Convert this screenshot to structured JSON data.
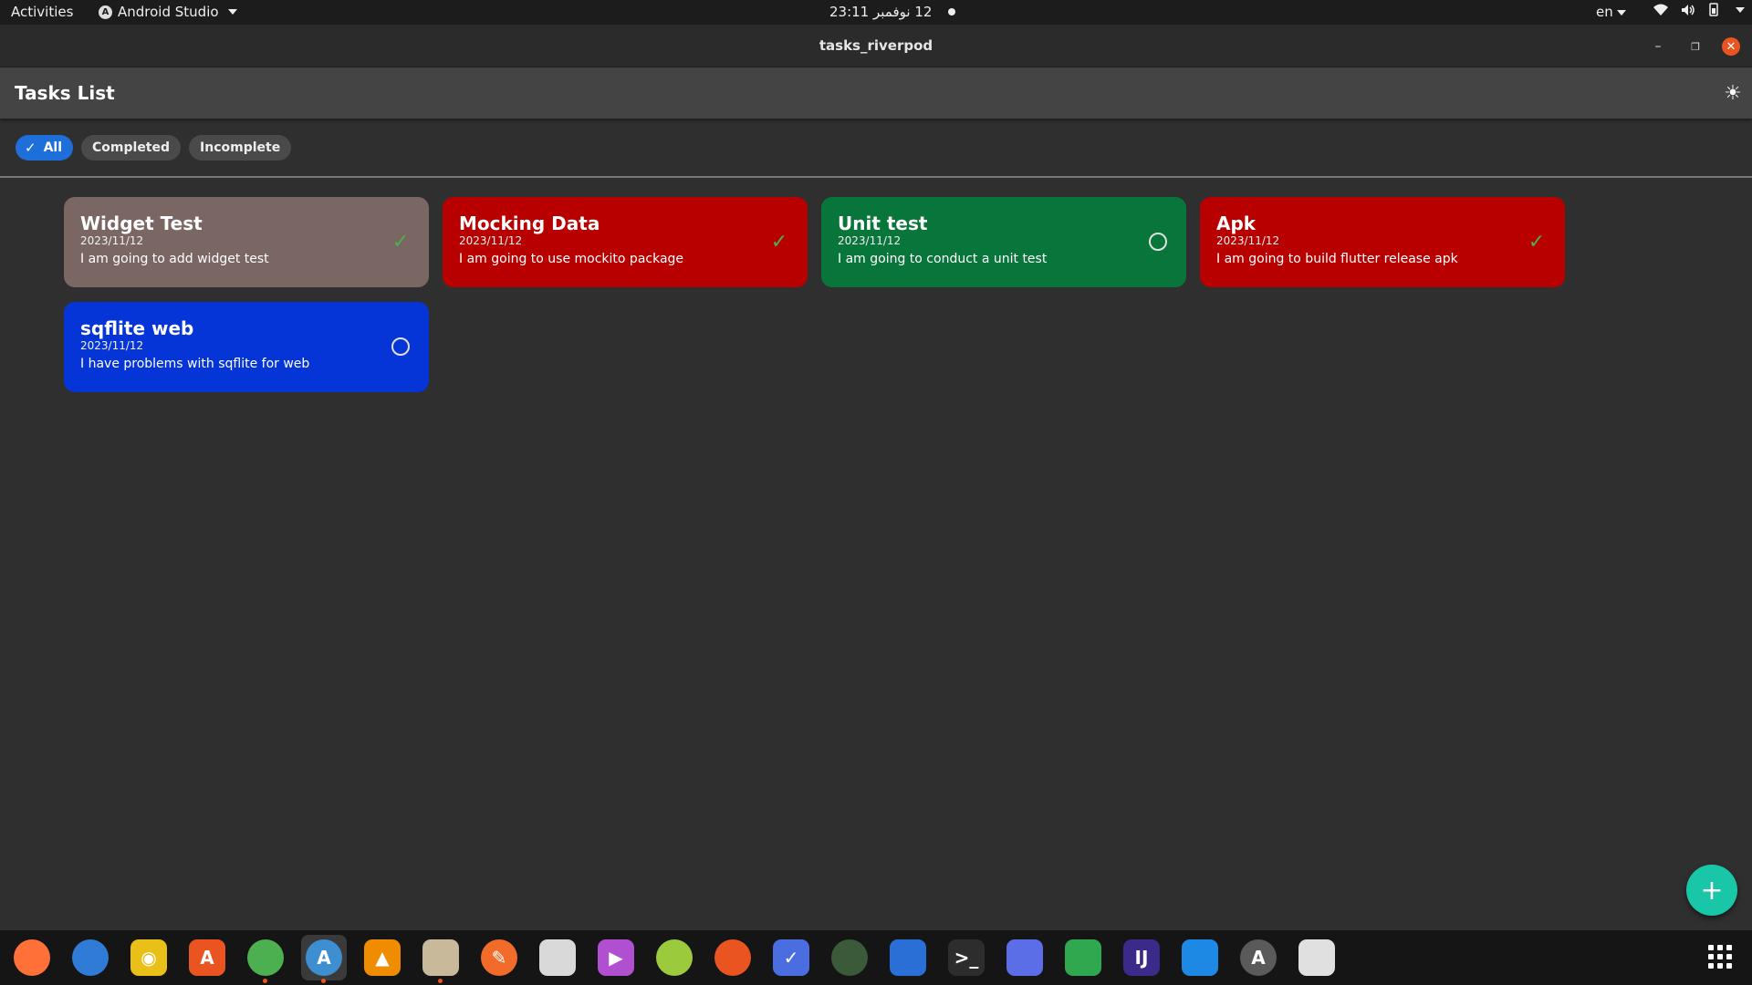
{
  "topbar": {
    "activities": "Activities",
    "app_name": "Android Studio",
    "clock": "12 نوفمبر 23:11",
    "lang": "en"
  },
  "window": {
    "title": "tasks_riverpod"
  },
  "app": {
    "title": "Tasks List",
    "filters": [
      "All",
      "Completed",
      "Incomplete"
    ],
    "selected_filter": "All"
  },
  "tasks": [
    {
      "title": "Widget Test",
      "date": "2023/11/12",
      "description": "I am going to add widget test",
      "completed": true,
      "color": "#7a6763"
    },
    {
      "title": "Mocking Data",
      "date": "2023/11/12",
      "description": "I am going to use mockito package",
      "completed": true,
      "color": "#b80000"
    },
    {
      "title": "Unit test",
      "date": "2023/11/12",
      "description": "I am going to conduct a unit test",
      "completed": false,
      "color": "#08763a"
    },
    {
      "title": "Apk",
      "date": "2023/11/12",
      "description": "I am going to build flutter release apk",
      "completed": true,
      "color": "#b80000"
    },
    {
      "title": "sqflite web",
      "date": "2023/11/12",
      "description": "I have problems with sqflite for web",
      "completed": false,
      "color": "#0535d6"
    }
  ],
  "dock": [
    {
      "name": "firefox-icon",
      "color": "#ff7139",
      "glyph": "",
      "round": true,
      "running": false
    },
    {
      "name": "thunderbird-icon",
      "color": "#2f7bd6",
      "glyph": "",
      "round": true,
      "running": false
    },
    {
      "name": "rhythmbox-icon",
      "color": "#e8c018",
      "glyph": "◉",
      "round": false,
      "running": false
    },
    {
      "name": "app-center-icon",
      "color": "#e95420",
      "glyph": "A",
      "round": false,
      "running": false
    },
    {
      "name": "chrome-icon",
      "color": "#4caf50",
      "glyph": "",
      "round": true,
      "running": true
    },
    {
      "name": "android-studio-icon",
      "color": "#3d8fd1",
      "glyph": "A",
      "round": true,
      "running": true
    },
    {
      "name": "vlc-icon",
      "color": "#f08c00",
      "glyph": "▲",
      "round": false,
      "running": false
    },
    {
      "name": "files-icon",
      "color": "#c8b99a",
      "glyph": "",
      "round": false,
      "running": true
    },
    {
      "name": "inkscape-icon",
      "color": "#f26b2a",
      "glyph": "✎",
      "round": true,
      "running": false
    },
    {
      "name": "document-viewer-icon",
      "color": "#d9d9d9",
      "glyph": "",
      "round": false,
      "running": false
    },
    {
      "name": "video-player-icon",
      "color": "#b04fcf",
      "glyph": "▶",
      "round": false,
      "running": false
    },
    {
      "name": "android-emulator-icon",
      "color": "#9bcb3c",
      "glyph": "",
      "round": true,
      "running": false
    },
    {
      "name": "ubuntu-icon",
      "color": "#e95420",
      "glyph": "",
      "round": true,
      "running": false
    },
    {
      "name": "tasks-icon",
      "color": "#4a6ee0",
      "glyph": "✓",
      "round": false,
      "running": false
    },
    {
      "name": "camera-icon",
      "color": "#3a5a3a",
      "glyph": "",
      "round": true,
      "running": false
    },
    {
      "name": "writer-icon",
      "color": "#2a6fd6",
      "glyph": "",
      "round": false,
      "running": false
    },
    {
      "name": "terminal-icon",
      "color": "#2d2d2d",
      "glyph": ">_",
      "round": false,
      "running": false
    },
    {
      "name": "screenshot-icon",
      "color": "#5b6ee8",
      "glyph": "",
      "round": false,
      "running": false
    },
    {
      "name": "calc-icon",
      "color": "#2fa84f",
      "glyph": "",
      "round": false,
      "running": false
    },
    {
      "name": "intellij-icon",
      "color": "#3b2a8a",
      "glyph": "IJ",
      "round": false,
      "running": false
    },
    {
      "name": "vscode-icon",
      "color": "#1e88e5",
      "glyph": "",
      "round": false,
      "running": false
    },
    {
      "name": "software-updater-icon",
      "color": "#5a5a5a",
      "glyph": "A",
      "round": true,
      "running": false
    },
    {
      "name": "usb-creator-icon",
      "color": "#e0e0e0",
      "glyph": "",
      "round": false,
      "running": false
    }
  ]
}
